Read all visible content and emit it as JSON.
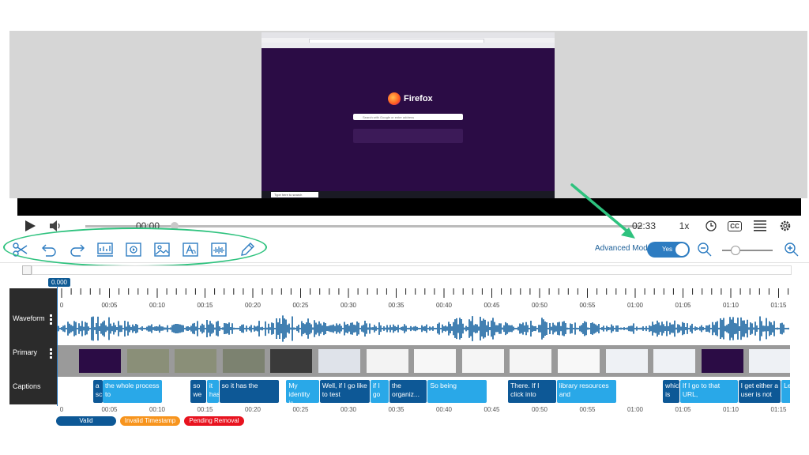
{
  "video": {
    "brand": "Firefox",
    "search_placeholder": "Search with Google or enter address",
    "taskbar_search": "Type here to search"
  },
  "player": {
    "current_time": "00:00",
    "duration": "02:33",
    "speed": "1x",
    "cc_label": "CC"
  },
  "toolbar": {
    "tools": [
      "scissors-icon",
      "undo-icon",
      "redo-icon",
      "slide-icon",
      "video-icon",
      "image-icon",
      "text-icon",
      "audio-icon",
      "pencil-icon"
    ],
    "advanced_mode_label": "Advanced Mode",
    "toggle_label": "Yes",
    "zoom_level": 0.17
  },
  "timeline": {
    "playhead_time": "0.000",
    "tick_labels": [
      "0",
      "00:05",
      "00:10",
      "00:15",
      "00:20",
      "00:25",
      "00:30",
      "00:35",
      "00:40",
      "00:45",
      "00:50",
      "00:55",
      "01:00",
      "01:05",
      "01:10",
      "01:15"
    ],
    "tracks": {
      "waveform_label": "Waveform",
      "primary_label": "Primary",
      "captions_label": "Captions"
    },
    "captions": [
      {
        "text": "a scre",
        "style": "dark",
        "start_sec": 3.3
      },
      {
        "text": "the whole process to",
        "style": "light",
        "start_sec": 4.3
      },
      {
        "text": "so we",
        "style": "dark",
        "start_sec": 13.5
      },
      {
        "text": "it has",
        "style": "light",
        "start_sec": 15.2
      },
      {
        "text": "so it has the",
        "style": "dark",
        "start_sec": 16.5
      },
      {
        "text": "My identity is",
        "style": "light",
        "start_sec": 23.5
      },
      {
        "text": "Well, if I go like to test",
        "style": "dark",
        "start_sec": 27.0
      },
      {
        "text": "if I go",
        "style": "light",
        "start_sec": 32.3
      },
      {
        "text": "the organiz...",
        "style": "dark",
        "start_sec": 34.3
      },
      {
        "text": "So being",
        "style": "light",
        "start_sec": 38.3
      },
      {
        "text": "There. If I click into",
        "style": "dark",
        "start_sec": 46.7
      },
      {
        "text": "library resources and",
        "style": "light",
        "start_sec": 51.8
      },
      {
        "text": "which is",
        "style": "dark",
        "start_sec": 62.9
      },
      {
        "text": "If I go to that URL,",
        "style": "light",
        "start_sec": 64.7
      },
      {
        "text": "I get either a user is not",
        "style": "dark",
        "start_sec": 70.8
      },
      {
        "text": "Let me anoth",
        "style": "light",
        "start_sec": 75.3
      }
    ],
    "legend": {
      "valid": "Valid",
      "invalid": "Invalid Timestamp",
      "pending": "Pending Removal"
    }
  },
  "colors": {
    "accent_blue": "#0d5896",
    "light_blue": "#29a8e8",
    "highlight_green": "#2ec27e",
    "legend_orange": "#f7941d",
    "legend_red": "#e8131f"
  }
}
